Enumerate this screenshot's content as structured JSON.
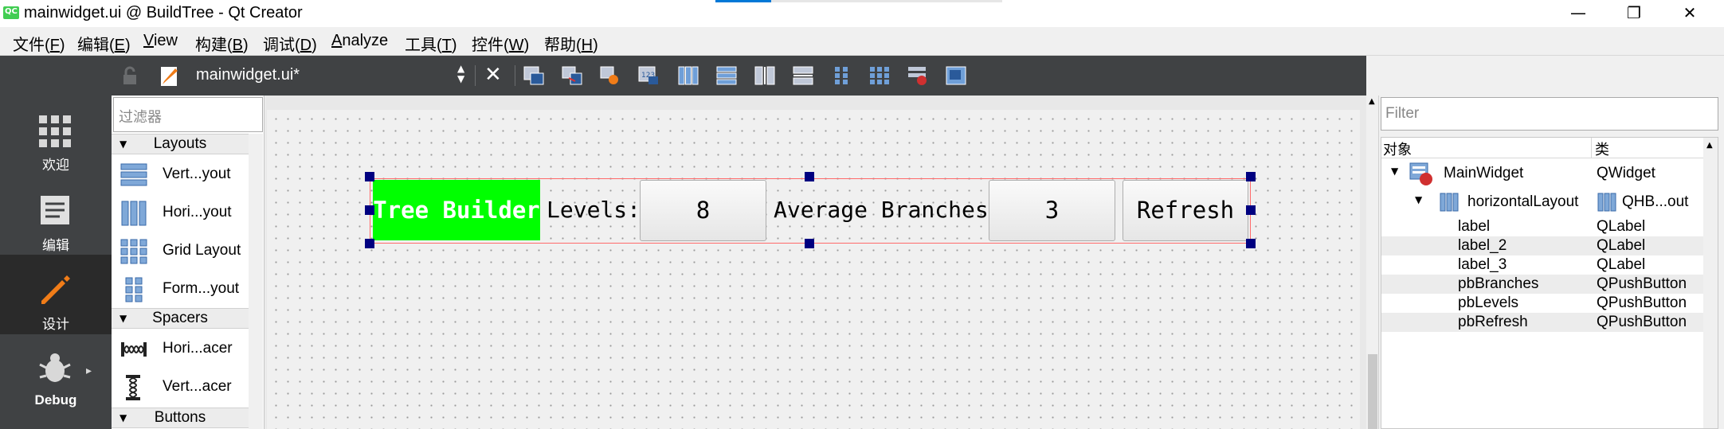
{
  "window": {
    "title": "mainwidget.ui @ BuildTree - Qt Creator",
    "minimize_glyph": "—",
    "maximize_glyph": "❐",
    "close_glyph": "✕"
  },
  "menu": [
    {
      "label": "文件(",
      "key": "F",
      "end": ")"
    },
    {
      "label": "编辑(",
      "key": "E",
      "end": ")"
    },
    {
      "label": "",
      "key": "V",
      "end": "iew"
    },
    {
      "label": "构建(",
      "key": "B",
      "end": ")"
    },
    {
      "label": "调试(",
      "key": "D",
      "end": ")"
    },
    {
      "label": "",
      "key": "A",
      "end": "nalyze"
    },
    {
      "label": "工具(",
      "key": "T",
      "end": ")"
    },
    {
      "label": "控件(",
      "key": "W",
      "end": ")"
    },
    {
      "label": "帮助(",
      "key": "H",
      "end": ")"
    }
  ],
  "modes": [
    {
      "label": "欢迎",
      "icon": "grid-icon"
    },
    {
      "label": "编辑",
      "icon": "document-icon"
    },
    {
      "label": "设计",
      "icon": "pencil-icon"
    },
    {
      "label": "Debug",
      "icon": "bug-icon",
      "arrow": "▸"
    }
  ],
  "toolbar": {
    "file": "mainwidget.ui*",
    "combo_up": "▲",
    "combo_down": "▼",
    "close_glyph": "✕"
  },
  "widgetbox": {
    "filter_placeholder": "过滤器",
    "tri": "▼",
    "categories": [
      {
        "label": "Layouts"
      },
      {
        "label": "Spacers"
      },
      {
        "label": "Buttons"
      }
    ],
    "items": [
      {
        "label": "Vert...yout"
      },
      {
        "label": "Hori...yout"
      },
      {
        "label": "Grid Layout"
      },
      {
        "label": "Form...yout"
      },
      {
        "label": "Hori...acer"
      },
      {
        "label": "Vert...acer"
      }
    ]
  },
  "form": {
    "label_tree": "Tree Builder",
    "label_levels": "Levels:",
    "btn_levels": "8",
    "label_branches": "Average Branches:",
    "btn_branches": "3",
    "btn_refresh": "Refresh"
  },
  "object_inspector": {
    "filter_placeholder": "Filter",
    "col_object": "对象",
    "col_class": "类",
    "expand_glyph": "▼",
    "rows": [
      {
        "object": "MainWidget",
        "class": "QWidget"
      },
      {
        "object": "horizontalLayout",
        "class": "QHB...out"
      },
      {
        "object": "label",
        "class": "QLabel"
      },
      {
        "object": "label_2",
        "class": "QLabel"
      },
      {
        "object": "label_3",
        "class": "QLabel"
      },
      {
        "object": "pbBranches",
        "class": "QPushButton"
      },
      {
        "object": "pbLevels",
        "class": "QPushButton"
      },
      {
        "object": "pbRefresh",
        "class": "QPushButton"
      }
    ]
  },
  "colors": {
    "dark_panel": "#404244",
    "active_mode": "#2a2a2a",
    "green_label": "#00ff00",
    "layout_border": "#ff6a6a",
    "handle": "#000080"
  }
}
